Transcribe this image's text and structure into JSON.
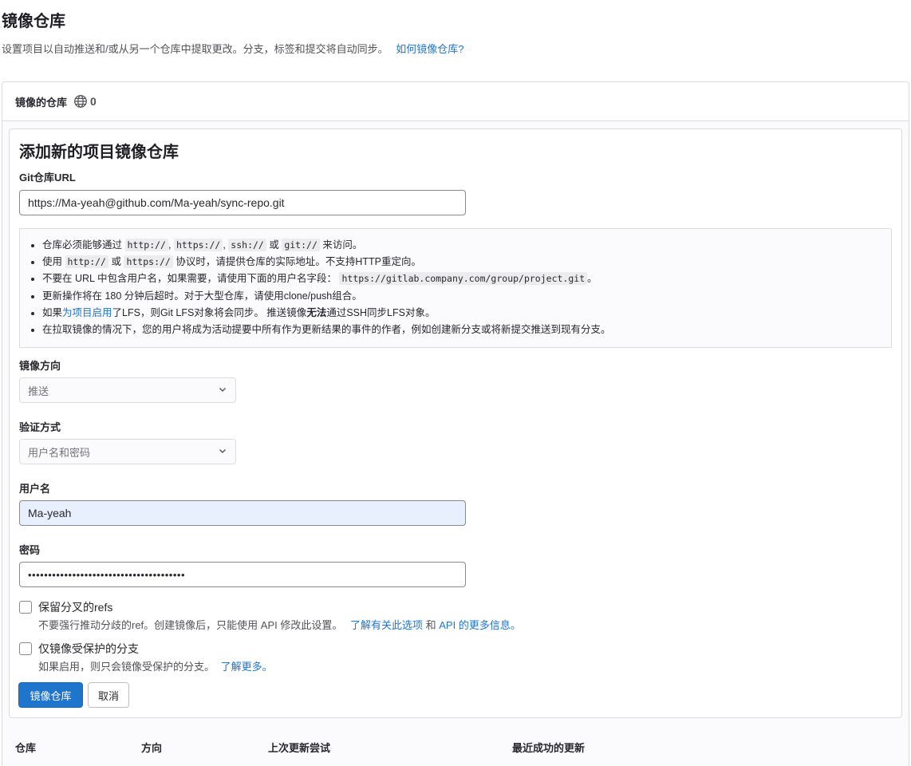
{
  "page": {
    "title": "镜像仓库",
    "description": "设置项目以自动推送和/或从另一个仓库中提取更改。分支，标签和提交将自动同步。",
    "help_link": "如何镜像仓库?"
  },
  "card": {
    "header_title": "镜像的仓库",
    "count": "0"
  },
  "form": {
    "title": "添加新的项目镜像仓库",
    "url_label": "Git仓库URL",
    "url_value": "https://Ma-yeah@github.com/Ma-yeah/sync-repo.git",
    "hints": {
      "h1": {
        "t1": "仓库必须能够通过",
        "c1": "http://",
        "t2": ",",
        "c2": "https://",
        "t3": ",",
        "c3": "ssh://",
        "t4": "或",
        "c4": "git://",
        "t5": "来访问。"
      },
      "h2": {
        "t1": "使用",
        "c1": "http://",
        "t2": "或",
        "c2": "https://",
        "t3": "协议时，请提供仓库的实际地址。不支持HTTP重定向。"
      },
      "h3": {
        "t1": "不要在 URL 中包含用户名，如果需要，请使用下面的用户名字段：",
        "c1": "https://gitlab.company.com/group/project.git",
        "t2": "。"
      },
      "h4": {
        "t1": "更新操作将在 180 分钟后超时。对于大型仓库，请使用clone/push组合。"
      },
      "h5": {
        "t1": "如果",
        "link": "为项目启用",
        "t2": "了LFS，则Git LFS对象将会同步。 推送镜像",
        "bold": "无法",
        "t3": "通过SSH同步LFS对象。"
      },
      "h6": {
        "t1": "在拉取镜像的情况下，您的用户将成为活动提要中所有作为更新结果的事件的作者，例如创建新分支或将新提交推送到现有分支。"
      }
    },
    "direction_label": "镜像方向",
    "direction_value": "推送",
    "auth_label": "验证方式",
    "auth_value": "用户名和密码",
    "username_label": "用户名",
    "username_value": "Ma-yeah",
    "password_label": "密码",
    "password_value": "•••••••••••••••••••••••••••••••••••••••",
    "keep_refs": {
      "label": "保留分叉的refs",
      "help": "不要强行推动分歧的ref。创建镜像后，只能使用 API 修改此设置。",
      "link1": "了解有关此选项",
      "and": "和",
      "link2": "API 的更多信息。"
    },
    "protected_only": {
      "label": "仅镜像受保护的分支",
      "help": "如果启用，则只会镜像受保护的分支。",
      "link": "了解更多。"
    },
    "submit_label": "镜像仓库",
    "cancel_label": "取消"
  },
  "table": {
    "columns": [
      "仓库",
      "方向",
      "上次更新尝试",
      "最近成功的更新"
    ]
  },
  "colors": {
    "accent": "#1f75cb",
    "autofill": "#e8f0fe"
  }
}
